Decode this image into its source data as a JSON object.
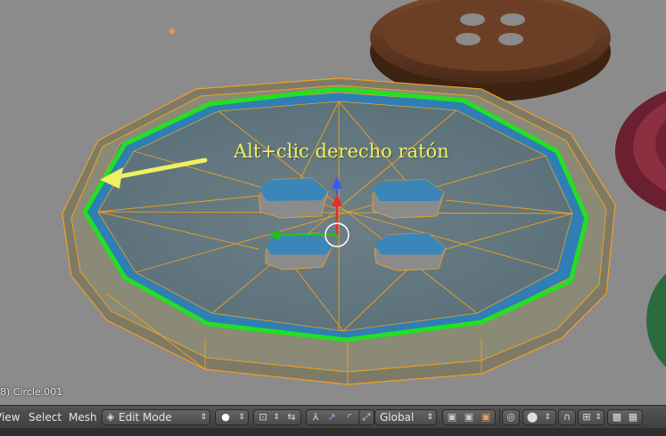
{
  "viewport": {
    "object_label": "8) Circle.001",
    "annotation": "Alt+clic derecho ratón"
  },
  "header": {
    "menu": [
      "View",
      "Select",
      "Mesh"
    ],
    "mode_dropdown": "Edit Mode",
    "orientation_dropdown": "Global"
  },
  "colors": {
    "viewport_bg": "#8b8b8b",
    "selection_green": "#22e022",
    "wire_orange": "#f0a020",
    "annotation_yellow": "#f0f060"
  }
}
